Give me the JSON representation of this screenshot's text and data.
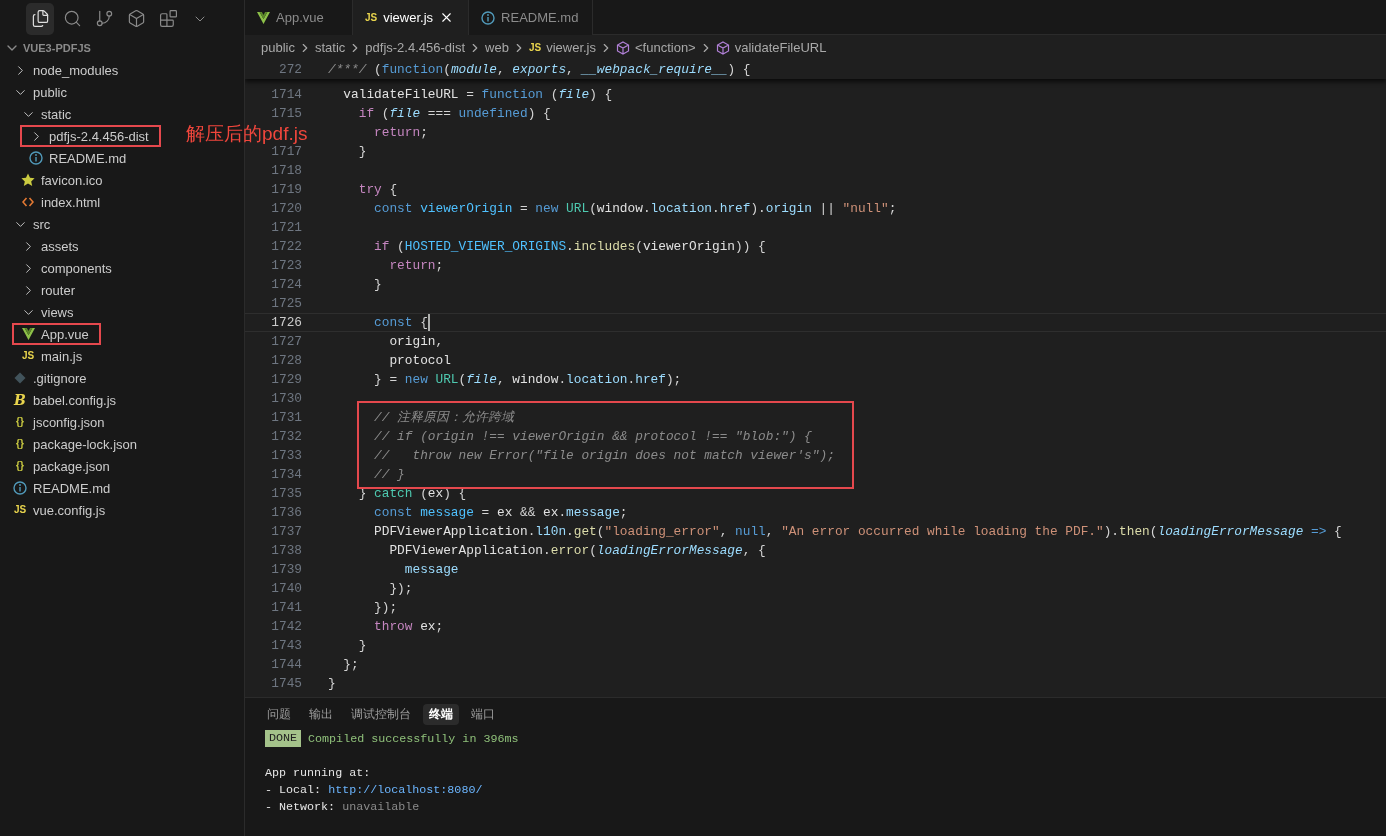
{
  "activity_bar": {
    "items": [
      {
        "selected": true
      },
      {
        "selected": false
      },
      {
        "selected": false
      },
      {
        "selected": false
      },
      {
        "selected": false
      },
      {
        "selected": false
      }
    ]
  },
  "explorer": {
    "title": "VUE3-PDFJS",
    "expanded": true,
    "items": [
      {
        "name": "node_modules",
        "kind": "folder",
        "expanded": false,
        "highlighted": false
      },
      {
        "name": "public",
        "kind": "folder",
        "expanded": true,
        "highlighted": false,
        "children": [
          {
            "name": "static",
            "kind": "folder",
            "expanded": true,
            "highlighted": false,
            "children": [
              {
                "name": "pdfjs-2.4.456-dist",
                "kind": "folder",
                "expanded": false,
                "highlighted": true,
                "note": "解压后的pdf.js"
              },
              {
                "name": "README.md",
                "kind": "info",
                "highlighted": false
              }
            ]
          },
          {
            "name": "favicon.ico",
            "kind": "star",
            "highlighted": false
          },
          {
            "name": "index.html",
            "kind": "html",
            "highlighted": false
          }
        ]
      },
      {
        "name": "src",
        "kind": "folder",
        "expanded": true,
        "highlighted": false,
        "children": [
          {
            "name": "assets",
            "kind": "folder",
            "expanded": false,
            "highlighted": false
          },
          {
            "name": "components",
            "kind": "folder",
            "expanded": false,
            "highlighted": false
          },
          {
            "name": "router",
            "kind": "folder",
            "expanded": false,
            "highlighted": false
          },
          {
            "name": "views",
            "kind": "folder",
            "expanded": true,
            "highlighted": false
          },
          {
            "name": "App.vue",
            "kind": "vue",
            "highlighted": true
          },
          {
            "name": "main.js",
            "kind": "js",
            "icon_text": "JS",
            "highlighted": false
          }
        ]
      },
      {
        "name": ".gitignore",
        "kind": "git",
        "highlighted": false
      },
      {
        "name": "babel.config.js",
        "kind": "babel",
        "icon_text": "B",
        "highlighted": false
      },
      {
        "name": "jsconfig.json",
        "kind": "json",
        "icon_text": "{}",
        "highlighted": false
      },
      {
        "name": "package-lock.json",
        "kind": "json",
        "icon_text": "{}",
        "highlighted": false
      },
      {
        "name": "package.json",
        "kind": "json",
        "icon_text": "{}",
        "highlighted": false
      },
      {
        "name": "README.md",
        "kind": "info",
        "highlighted": false
      },
      {
        "name": "vue.config.js",
        "kind": "js",
        "icon_text": "JS",
        "highlighted": false
      }
    ]
  },
  "tabs": [
    {
      "label": "App.vue",
      "kind": "vue",
      "selected": false
    },
    {
      "label": "viewer.js",
      "kind": "js",
      "icon_text": "JS",
      "selected": true
    },
    {
      "label": "README.md",
      "kind": "info",
      "selected": false
    }
  ],
  "breadcrumb": [
    {
      "label": "public"
    },
    {
      "label": "static"
    },
    {
      "label": "pdfjs-2.4.456-dist"
    },
    {
      "label": "web"
    },
    {
      "label": "viewer.js",
      "kind": "js",
      "icon_text": "JS"
    },
    {
      "label": "<function>",
      "kind": "symbol"
    },
    {
      "label": "validateFileURL",
      "kind": "symbol"
    }
  ],
  "code": {
    "sticky": {
      "number": "272",
      "tokens": [
        {
          "kind": "cmt",
          "text": "/***/"
        },
        {
          "kind": "plain",
          "text": " ("
        },
        {
          "kind": "kw",
          "text": "function"
        },
        {
          "kind": "plain",
          "text": "("
        },
        {
          "kind": "param",
          "text": "module"
        },
        {
          "kind": "plain",
          "text": ", "
        },
        {
          "kind": "param",
          "text": "exports"
        },
        {
          "kind": "plain",
          "text": ", "
        },
        {
          "kind": "param",
          "text": "__webpack_require__"
        },
        {
          "kind": "plain",
          "text": ") {"
        }
      ]
    },
    "lines": [
      {
        "number": "1714",
        "current": false,
        "boxed": false,
        "tokens": [
          {
            "kind": "id",
            "text": "  validateFileURL"
          },
          {
            "kind": "plain",
            "text": " = "
          },
          {
            "kind": "kw",
            "text": "function"
          },
          {
            "kind": "plain",
            "text": " ("
          },
          {
            "kind": "param",
            "text": "file"
          },
          {
            "kind": "plain",
            "text": ") {"
          }
        ]
      },
      {
        "number": "1715",
        "current": false,
        "boxed": false,
        "tokens": [
          {
            "kind": "ctl",
            "text": "    if"
          },
          {
            "kind": "plain",
            "text": " ("
          },
          {
            "kind": "param",
            "text": "file"
          },
          {
            "kind": "plain",
            "text": " === "
          },
          {
            "kind": "kw",
            "text": "undefined"
          },
          {
            "kind": "plain",
            "text": ") {"
          }
        ]
      },
      {
        "current": false,
        "boxed": false,
        "tokens": [
          {
            "kind": "ctl",
            "text": "      return"
          },
          {
            "kind": "plain",
            "text": ";"
          }
        ]
      },
      {
        "number": "1717",
        "current": false,
        "boxed": false,
        "tokens": [
          {
            "kind": "plain",
            "text": "    }"
          }
        ]
      },
      {
        "number": "1718",
        "current": false,
        "boxed": false
      },
      {
        "number": "1719",
        "current": false,
        "boxed": false,
        "tokens": [
          {
            "kind": "ctl",
            "text": "    try"
          },
          {
            "kind": "plain",
            "text": " {"
          }
        ]
      },
      {
        "number": "1720",
        "current": false,
        "boxed": false,
        "tokens": [
          {
            "kind": "kw",
            "text": "      const "
          },
          {
            "kind": "cst",
            "text": "viewerOrigin"
          },
          {
            "kind": "plain",
            "text": " = "
          },
          {
            "kind": "kw",
            "text": "new "
          },
          {
            "kind": "type",
            "text": "URL"
          },
          {
            "kind": "plain",
            "text": "("
          },
          {
            "kind": "id",
            "text": "window"
          },
          {
            "kind": "plain",
            "text": "."
          },
          {
            "kind": "prop",
            "text": "location"
          },
          {
            "kind": "plain",
            "text": "."
          },
          {
            "kind": "prop",
            "text": "href"
          },
          {
            "kind": "plain",
            "text": ")."
          },
          {
            "kind": "prop",
            "text": "origin"
          },
          {
            "kind": "plain",
            "text": " || "
          },
          {
            "kind": "str",
            "text": "\"null\""
          },
          {
            "kind": "plain",
            "text": ";"
          }
        ]
      },
      {
        "number": "1721",
        "current": false,
        "boxed": false
      },
      {
        "number": "1722",
        "current": false,
        "boxed": false,
        "tokens": [
          {
            "kind": "ctl",
            "text": "      if"
          },
          {
            "kind": "plain",
            "text": " ("
          },
          {
            "kind": "cst",
            "text": "HOSTED_VIEWER_ORIGINS"
          },
          {
            "kind": "plain",
            "text": "."
          },
          {
            "kind": "fn",
            "text": "includes"
          },
          {
            "kind": "plain",
            "text": "("
          },
          {
            "kind": "id",
            "text": "viewerOrigin"
          },
          {
            "kind": "plain",
            "text": ")) {"
          }
        ]
      },
      {
        "number": "1723",
        "current": false,
        "boxed": false,
        "tokens": [
          {
            "kind": "ctl",
            "text": "        return"
          },
          {
            "kind": "plain",
            "text": ";"
          }
        ]
      },
      {
        "number": "1724",
        "current": false,
        "boxed": false,
        "tokens": [
          {
            "kind": "plain",
            "text": "      }"
          }
        ]
      },
      {
        "number": "1725",
        "current": false,
        "boxed": false
      },
      {
        "number": "1726",
        "current": true,
        "boxed": false,
        "tokens": [
          {
            "kind": "kw",
            "text": "      const"
          },
          {
            "kind": "plain",
            "text": " {"
          }
        ]
      },
      {
        "number": "1727",
        "current": false,
        "boxed": false,
        "tokens": [
          {
            "kind": "id",
            "text": "        origin"
          },
          {
            "kind": "plain",
            "text": ","
          }
        ]
      },
      {
        "number": "1728",
        "current": false,
        "boxed": false,
        "tokens": [
          {
            "kind": "id",
            "text": "        protocol"
          }
        ]
      },
      {
        "number": "1729",
        "current": false,
        "boxed": false,
        "tokens": [
          {
            "kind": "plain",
            "text": "      } = "
          },
          {
            "kind": "kw",
            "text": "new "
          },
          {
            "kind": "type",
            "text": "URL"
          },
          {
            "kind": "plain",
            "text": "("
          },
          {
            "kind": "param",
            "text": "file"
          },
          {
            "kind": "plain",
            "text": ", "
          },
          {
            "kind": "id",
            "text": "window"
          },
          {
            "kind": "plain",
            "text": "."
          },
          {
            "kind": "prop",
            "text": "location"
          },
          {
            "kind": "plain",
            "text": "."
          },
          {
            "kind": "prop",
            "text": "href"
          },
          {
            "kind": "plain",
            "text": ");"
          }
        ]
      },
      {
        "number": "1730",
        "current": false,
        "boxed": false
      },
      {
        "number": "1731",
        "current": false,
        "boxed": true,
        "tokens": [
          {
            "kind": "cmt",
            "text": "      // 注释原因：允许跨域"
          }
        ]
      },
      {
        "number": "1732",
        "current": false,
        "boxed": true,
        "tokens": [
          {
            "kind": "cmt",
            "text": "      // if (origin !== viewerOrigin && protocol !== \"blob:\") {"
          }
        ]
      },
      {
        "number": "1733",
        "current": false,
        "boxed": true,
        "tokens": [
          {
            "kind": "cmt",
            "text": "      //   throw new Error(\"file origin does not match viewer's\");"
          }
        ]
      },
      {
        "number": "1734",
        "current": false,
        "boxed": true,
        "tokens": [
          {
            "kind": "cmt",
            "text": "      // }"
          }
        ]
      },
      {
        "number": "1735",
        "current": false,
        "boxed": false,
        "tokens": [
          {
            "kind": "plain",
            "text": "    } "
          },
          {
            "kind": "type",
            "text": "catch"
          },
          {
            "kind": "plain",
            "text": " ("
          },
          {
            "kind": "id",
            "text": "ex"
          },
          {
            "kind": "plain",
            "text": ") {"
          }
        ]
      },
      {
        "number": "1736",
        "current": false,
        "boxed": false,
        "tokens": [
          {
            "kind": "kw",
            "text": "      const "
          },
          {
            "kind": "cst",
            "text": "message"
          },
          {
            "kind": "plain",
            "text": " = "
          },
          {
            "kind": "id",
            "text": "ex"
          },
          {
            "kind": "plain",
            "text": " && "
          },
          {
            "kind": "id",
            "text": "ex"
          },
          {
            "kind": "plain",
            "text": "."
          },
          {
            "kind": "prop",
            "text": "message"
          },
          {
            "kind": "plain",
            "text": ";"
          }
        ]
      },
      {
        "number": "1737",
        "current": false,
        "boxed": false,
        "tokens": [
          {
            "kind": "id",
            "text": "      PDFViewerApplication"
          },
          {
            "kind": "plain",
            "text": "."
          },
          {
            "kind": "prop",
            "text": "l10n"
          },
          {
            "kind": "plain",
            "text": "."
          },
          {
            "kind": "fn",
            "text": "get"
          },
          {
            "kind": "plain",
            "text": "("
          },
          {
            "kind": "str",
            "text": "\"loading_error\""
          },
          {
            "kind": "plain",
            "text": ", "
          },
          {
            "kind": "kw",
            "text": "null"
          },
          {
            "kind": "plain",
            "text": ", "
          },
          {
            "kind": "str",
            "text": "\"An error occurred while loading the PDF.\""
          },
          {
            "kind": "plain",
            "text": ")."
          },
          {
            "kind": "fn",
            "text": "then"
          },
          {
            "kind": "plain",
            "text": "("
          },
          {
            "kind": "param",
            "text": "loadingErrorMessage"
          },
          {
            "kind": "kw",
            "text": " =>"
          },
          {
            "kind": "plain",
            "text": " {"
          }
        ]
      },
      {
        "number": "1738",
        "current": false,
        "boxed": false,
        "tokens": [
          {
            "kind": "id",
            "text": "        PDFViewerApplication"
          },
          {
            "kind": "plain",
            "text": "."
          },
          {
            "kind": "fn",
            "text": "error"
          },
          {
            "kind": "plain",
            "text": "("
          },
          {
            "kind": "param",
            "text": "loadingErrorMessage"
          },
          {
            "kind": "plain",
            "text": ", {"
          }
        ]
      },
      {
        "number": "1739",
        "current": false,
        "boxed": false,
        "tokens": [
          {
            "kind": "prop",
            "text": "          message"
          }
        ]
      },
      {
        "number": "1740",
        "current": false,
        "boxed": false,
        "tokens": [
          {
            "kind": "plain",
            "text": "        });"
          }
        ]
      },
      {
        "number": "1741",
        "current": false,
        "boxed": false,
        "tokens": [
          {
            "kind": "plain",
            "text": "      });"
          }
        ]
      },
      {
        "number": "1742",
        "current": false,
        "boxed": false,
        "tokens": [
          {
            "kind": "ctl",
            "text": "      throw "
          },
          {
            "kind": "id",
            "text": "ex"
          },
          {
            "kind": "plain",
            "text": ";"
          }
        ]
      },
      {
        "number": "1743",
        "current": false,
        "boxed": false,
        "tokens": [
          {
            "kind": "plain",
            "text": "    }"
          }
        ]
      },
      {
        "number": "1744",
        "current": false,
        "boxed": false,
        "tokens": [
          {
            "kind": "plain",
            "text": "  };"
          }
        ]
      },
      {
        "number": "1745",
        "current": false,
        "boxed": false,
        "tokens": [
          {
            "kind": "plain",
            "text": "}"
          }
        ]
      }
    ]
  },
  "panel": {
    "tabs": [
      {
        "label": "问题",
        "selected": false
      },
      {
        "label": "输出",
        "selected": false
      },
      {
        "label": "调试控制台",
        "selected": false
      },
      {
        "label": "终端",
        "selected": true
      },
      {
        "label": "端口",
        "selected": false
      }
    ],
    "terminal": [
      {
        "tokens": [
          {
            "kind": "badge",
            "text": "DONE"
          },
          {
            "kind": "ok",
            "text": "Compiled successfully in 396ms"
          }
        ]
      },
      {
        "tokens": [
          {
            "kind": "plain",
            "text": "  App running at:"
          }
        ]
      },
      {
        "tokens": [
          {
            "kind": "plain",
            "text": "  - Local:   "
          },
          {
            "kind": "link",
            "text": "http://localhost:8080/"
          }
        ]
      },
      {
        "tokens": [
          {
            "kind": "plain",
            "text": "  - Network: "
          },
          {
            "kind": "dim",
            "text": "unavailable"
          }
        ]
      }
    ]
  }
}
